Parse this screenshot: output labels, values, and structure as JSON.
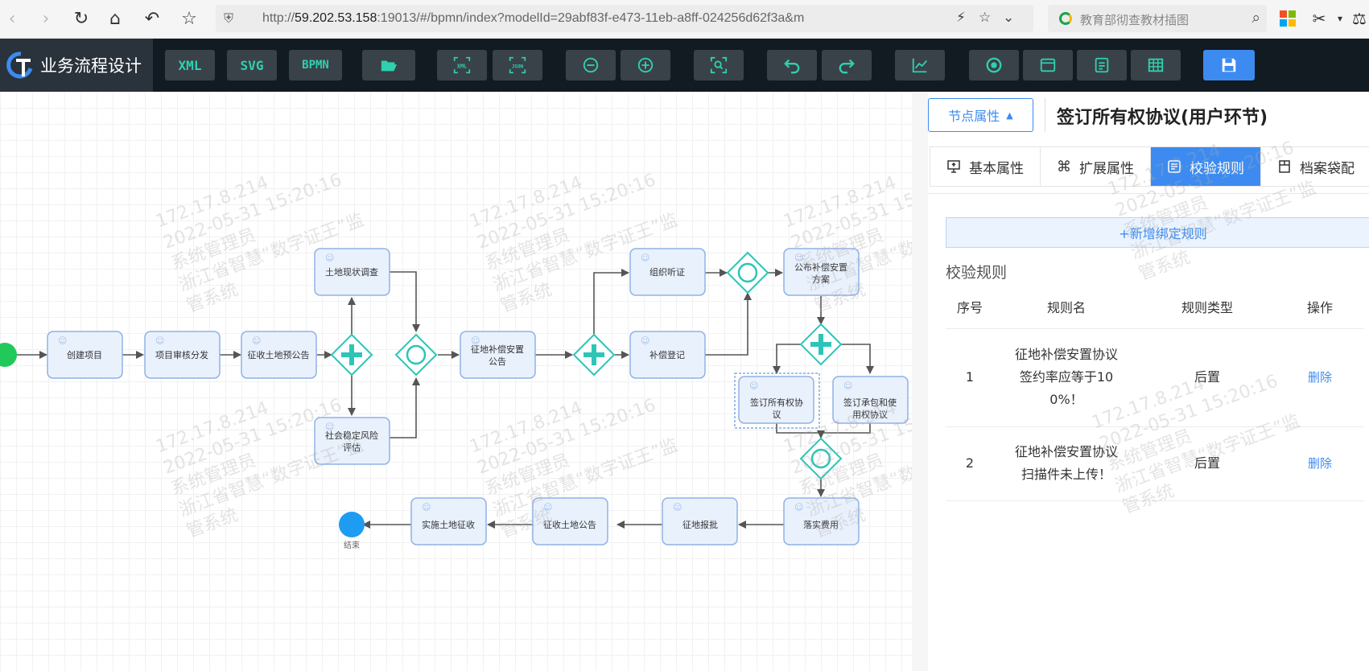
{
  "browser": {
    "url_prefix": "http://",
    "url_host": "59.202.53.158",
    "url_rest": ":19013/#/bpmn/index?modelId=29abf83f-e473-11eb-a8ff-024256d62f3a&m",
    "search_text": "教育部彻查教材插图"
  },
  "toolbar": {
    "app_title": "业务流程设计",
    "xml_label": "XML",
    "svg_label": "SVG",
    "bpmn_label": "BPMN"
  },
  "diagram": {
    "nodes": {
      "create_project": "创建项目",
      "review_dispatch": "项目审核分发",
      "pre_notice": "征收土地预公告",
      "land_survey_1": "土地现状调查",
      "risk_assessment_1": "社会稳定风险",
      "risk_assessment_2": "评估",
      "comp_notice_1": "征地补偿安置",
      "comp_notice_2": "公告",
      "hearing": "组织听证",
      "comp_register": "补偿登记",
      "publish_plan_1": "公布补偿安置",
      "publish_plan_2": "方案",
      "sign_own_1": "签订所有权协",
      "sign_own_2": "议",
      "sign_use_1": "签订承包和使",
      "sign_use_2": "用权协议",
      "fee": "落实费用",
      "approval": "征地报批",
      "land_notice": "征收土地公告",
      "implement": "实施土地征收",
      "end": "结束"
    }
  },
  "panel": {
    "node_props_label": "节点属性",
    "title": "签订所有权协议(用户环节)",
    "tabs": [
      "基本属性",
      "扩展属性",
      "校验规则",
      "档案袋配"
    ],
    "add_rule_label": "+新增绑定规则",
    "section_title": "校验规则",
    "columns": [
      "序号",
      "规则名",
      "规则类型",
      "操作"
    ],
    "rows": [
      {
        "no": "1",
        "name_lines": [
          "征地补偿安置协议",
          "签约率应等于10",
          "0%！"
        ],
        "type": "后置",
        "action": "删除"
      },
      {
        "no": "2",
        "name_lines": [
          "征地补偿安置协议",
          "扫描件未上传！"
        ],
        "type": "后置",
        "action": "删除"
      }
    ]
  },
  "watermark": {
    "ip": "172.17.8.214",
    "time": "2022-05-31 15:20:16",
    "user": "系统管理员",
    "system_1": "浙江省智慧“数字证王”监",
    "system_2": "管系统"
  },
  "colors": {
    "accent": "#3d8bf0",
    "toolbar_icon": "#2fd0b0",
    "task_fill": "#e9f1fd",
    "gateway": "#2cc5b8",
    "start": "#21c95a",
    "end": "#1e9cf2"
  }
}
